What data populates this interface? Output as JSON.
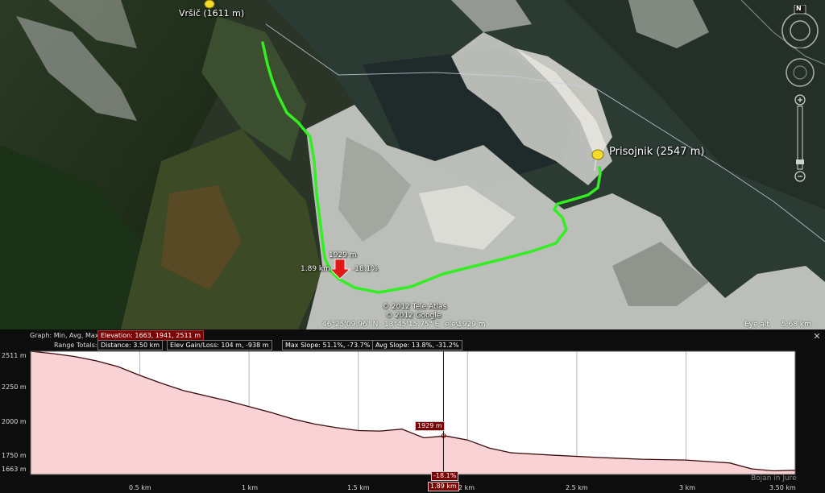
{
  "map": {
    "places": [
      {
        "name": "Vršič (1611 m)"
      },
      {
        "name": "Prisojnik (2547 m)"
      }
    ],
    "cursor": {
      "distance": "1.89 km",
      "elevation": "1929 m",
      "slope": "-18.1%"
    },
    "copyright": [
      "© 2012 Tele Atlas",
      "© 2012 Google"
    ],
    "status": {
      "lat": "46°25'09.96\" N",
      "lon": "13°45'15.75\" E",
      "elev_label": "elev",
      "elev": "1929 m",
      "eye_label": "Eye alt",
      "eye": "5.68 km"
    },
    "compass_north": "N",
    "colors": {
      "route": "#33ee22",
      "pin": "#f3dd2a",
      "cursor_arrow": "#e01818"
    }
  },
  "profile": {
    "graph_label": "Graph: Min, Avg, Max",
    "elevation_summary": "Elevation: 1663, 1941, 2511 m",
    "range_label": "Range Totals:",
    "distance": "Distance: 3.50 km",
    "gain_loss": "Elev Gain/Loss: 104 m, -938 m",
    "max_slope": "Max Slope: 51.1%, -73.7%",
    "avg_slope": "Avg Slope: 13.8%, -31.2%",
    "close": "✕",
    "y_ticks": [
      "2511 m",
      "2250 m",
      "2000 m",
      "1750 m",
      "1663 m"
    ],
    "x_ticks": [
      "0.5 km",
      "1 km",
      "1.5 km",
      "2 km",
      "2.5 km",
      "3 km",
      "3.50 km"
    ],
    "cursor_elev": "1929 m",
    "cursor_slope": "-18.1%",
    "cursor_dist": "1.89 km",
    "watermark": "Bojan in Jure",
    "colors": {
      "fill": "#f9d2d5",
      "line": "#3a0a0a",
      "cursor": "#7a0000"
    }
  },
  "chart_data": {
    "type": "area",
    "xlabel": "",
    "ylabel": "",
    "xlim": [
      0,
      3.5
    ],
    "ylim": [
      1663,
      2511
    ],
    "x": [
      0,
      0.1,
      0.2,
      0.3,
      0.4,
      0.5,
      0.6,
      0.7,
      0.8,
      0.9,
      1.0,
      1.1,
      1.2,
      1.3,
      1.4,
      1.5,
      1.6,
      1.7,
      1.8,
      1.85,
      1.9,
      2.0,
      2.1,
      2.2,
      2.4,
      2.6,
      2.8,
      3.0,
      3.2,
      3.3,
      3.4,
      3.5
    ],
    "series": [
      {
        "values": [
          2511,
          2495,
          2475,
          2445,
          2405,
          2345,
          2290,
          2240,
          2205,
          2170,
          2130,
          2090,
          2045,
          2010,
          1985,
          1965,
          1962,
          1975,
          1915,
          1922,
          1928,
          1900,
          1845,
          1812,
          1795,
          1780,
          1768,
          1762,
          1742,
          1702,
          1688,
          1692
        ]
      }
    ]
  }
}
